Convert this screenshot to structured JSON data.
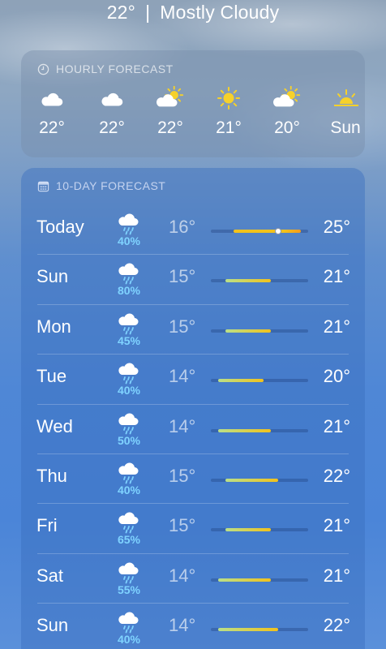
{
  "summary": {
    "temp": "22°",
    "separator": "|",
    "condition": "Mostly Cloudy"
  },
  "hourly": {
    "header": "HOURLY FORECAST",
    "header_icon": "clock-icon",
    "items": [
      {
        "label": "22°",
        "icon": "cloud-icon"
      },
      {
        "label": "22°",
        "icon": "cloud-icon"
      },
      {
        "label": "22°",
        "icon": "partly-sunny-icon"
      },
      {
        "label": "21°",
        "icon": "sun-icon"
      },
      {
        "label": "20°",
        "icon": "partly-sunny-icon"
      },
      {
        "label": "Sun",
        "icon": "sunset-icon"
      }
    ]
  },
  "daily": {
    "header": "10-DAY FORECAST",
    "header_icon": "calendar-icon",
    "range_min": 13,
    "range_max": 26,
    "current_temp": 22,
    "days": [
      {
        "day": "Today",
        "precip": "40%",
        "low": "16°",
        "high": "25°",
        "low_val": 16,
        "high_val": 25,
        "icon": "rain-cloud-icon"
      },
      {
        "day": "Sun",
        "precip": "80%",
        "low": "15°",
        "high": "21°",
        "low_val": 15,
        "high_val": 21,
        "icon": "rain-cloud-icon"
      },
      {
        "day": "Mon",
        "precip": "45%",
        "low": "15°",
        "high": "21°",
        "low_val": 15,
        "high_val": 21,
        "icon": "rain-cloud-icon"
      },
      {
        "day": "Tue",
        "precip": "40%",
        "low": "14°",
        "high": "20°",
        "low_val": 14,
        "high_val": 20,
        "icon": "rain-cloud-icon"
      },
      {
        "day": "Wed",
        "precip": "50%",
        "low": "14°",
        "high": "21°",
        "low_val": 14,
        "high_val": 21,
        "icon": "rain-cloud-icon"
      },
      {
        "day": "Thu",
        "precip": "40%",
        "low": "15°",
        "high": "22°",
        "low_val": 15,
        "high_val": 22,
        "icon": "rain-cloud-icon"
      },
      {
        "day": "Fri",
        "precip": "65%",
        "low": "15°",
        "high": "21°",
        "low_val": 15,
        "high_val": 21,
        "icon": "rain-cloud-icon"
      },
      {
        "day": "Sat",
        "precip": "55%",
        "low": "14°",
        "high": "21°",
        "low_val": 14,
        "high_val": 21,
        "icon": "rain-cloud-icon"
      },
      {
        "day": "Sun",
        "precip": "40%",
        "low": "14°",
        "high": "22°",
        "low_val": 14,
        "high_val": 22,
        "icon": "rain-cloud-icon"
      }
    ]
  },
  "colors": {
    "precip": "#7fd3ff",
    "bar_warm": "#f2c21b",
    "bar_cool": "#b9e08a",
    "bar_orange": "#f59a1b"
  }
}
